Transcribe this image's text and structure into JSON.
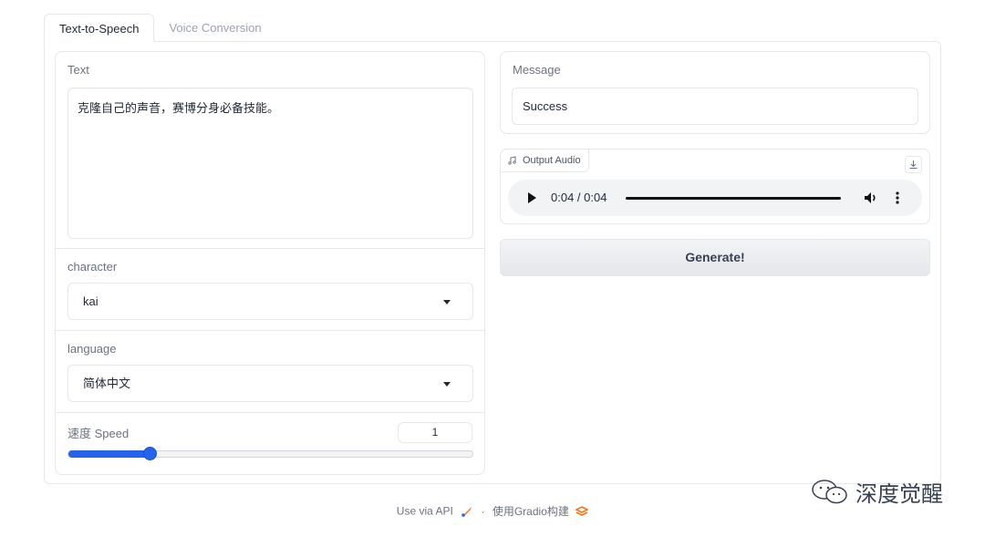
{
  "tabs": [
    {
      "label": "Text-to-Speech",
      "active": true
    },
    {
      "label": "Voice Conversion",
      "active": false
    }
  ],
  "text_block": {
    "label": "Text",
    "value": "克隆自己的声音，赛博分身必备技能。"
  },
  "character": {
    "label": "character",
    "selected": "kai"
  },
  "language": {
    "label": "language",
    "selected": "简体中文"
  },
  "speed": {
    "label": "速度 Speed",
    "value": "1",
    "slider_fraction": 0.2
  },
  "message": {
    "label": "Message",
    "value": "Success"
  },
  "output_audio": {
    "label": "Output Audio",
    "time": "0:04 / 0:04",
    "progress_fraction": 1.0
  },
  "generate_button": {
    "label": "Generate!"
  },
  "footer": {
    "api_link": "Use via API",
    "separator": "·",
    "built_with": "使用Gradio构建"
  },
  "watermark": {
    "text": "深度觉醒"
  },
  "colors": {
    "accent": "#2563eb",
    "border": "#e5e7eb",
    "gradio_logo": "#f97316"
  }
}
